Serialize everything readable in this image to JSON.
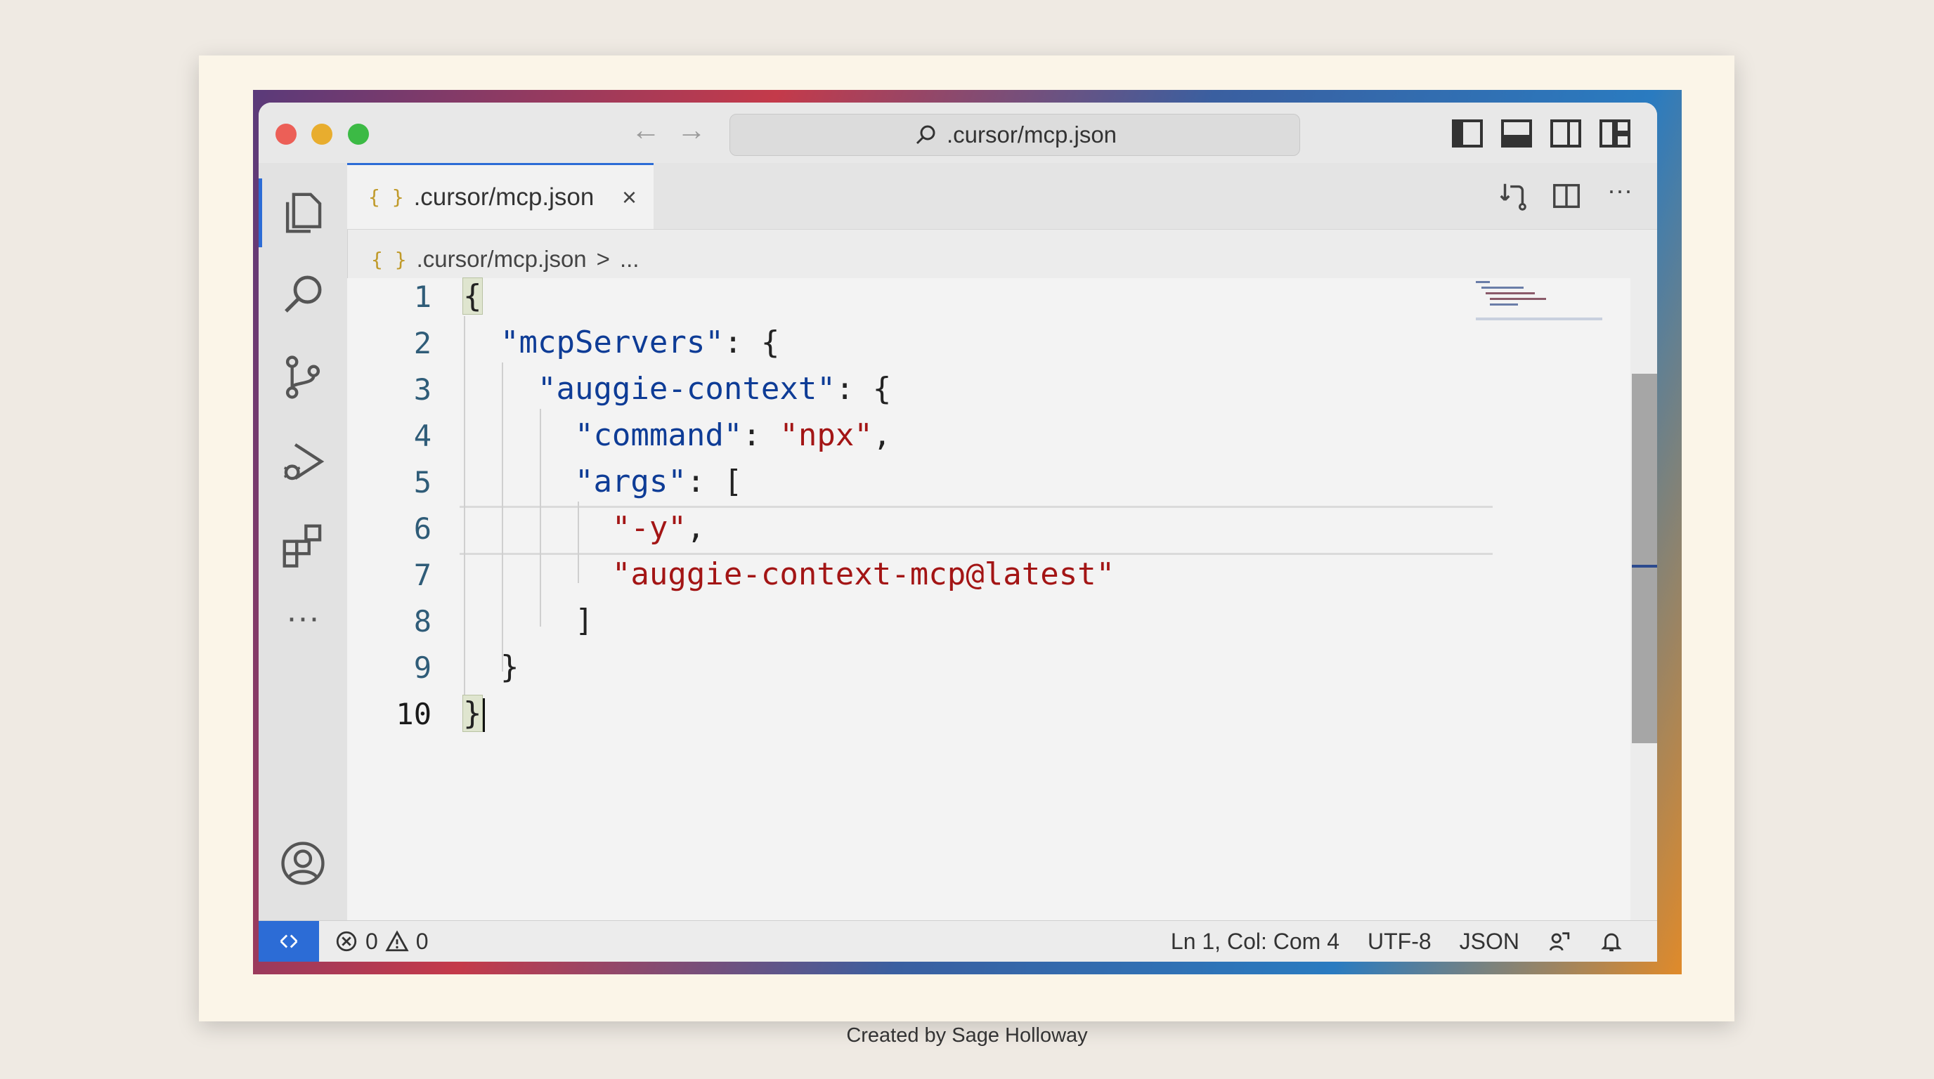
{
  "window": {
    "command_center": ".cursor/mcp.json"
  },
  "tab": {
    "label": ".cursor/mcp.json",
    "icon": "{ }",
    "close": "×"
  },
  "breadcrumb": {
    "file": ".cursor/mcp.json",
    "separator": ">",
    "more": "..."
  },
  "activity_icons": [
    "explorer-icon",
    "search-icon",
    "source-control-icon",
    "run-debug-icon",
    "extensions-icon",
    "more-icon",
    "account-icon",
    "settings-icon"
  ],
  "editor": {
    "line_numbers": [
      "1",
      "2",
      "3",
      "4",
      "5",
      "6",
      "7",
      "8",
      "9",
      "10"
    ],
    "lines": [
      "{",
      "  \"mcpServers\": {",
      "    \"auggie-context\": {",
      "      \"command\": \"npx\",",
      "      \"args\": [",
      "        \"-y\",",
      "        \"auggie-context-mcp@latest\"",
      "      ]",
      "    }",
      "}"
    ]
  },
  "status": {
    "errors": "0",
    "warnings": "0",
    "position": "Ln 1, Col: Com 4",
    "encoding": "UTF-8",
    "language": "JSON"
  },
  "caption": "Created by Sage Holloway",
  "colors": {
    "accent": "#2c6cd6",
    "key": "#0e3c96",
    "string": "#a31515"
  }
}
